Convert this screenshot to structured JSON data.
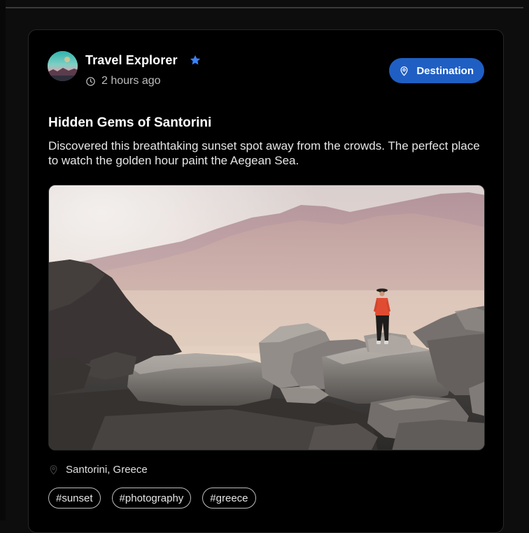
{
  "post": {
    "author": {
      "name": "Travel Explorer",
      "verified": true
    },
    "time": "2 hours ago",
    "category_label": "Destination",
    "title": "Hidden Gems of Santorini",
    "body": "Discovered this breathtaking sunset spot away from the crowds. The perfect place to watch the golden hour paint the Aegean Sea.",
    "location": "Santorini, Greece",
    "tags": [
      "#sunset",
      "#photography",
      "#greece"
    ]
  },
  "icons": {
    "verified": "star-icon",
    "time": "clock-icon",
    "category": "map-pin-icon",
    "location": "map-pin-icon"
  },
  "colors": {
    "accent": "#1f5fc4",
    "verified_star": "#3b82f6",
    "background": "#000000"
  }
}
